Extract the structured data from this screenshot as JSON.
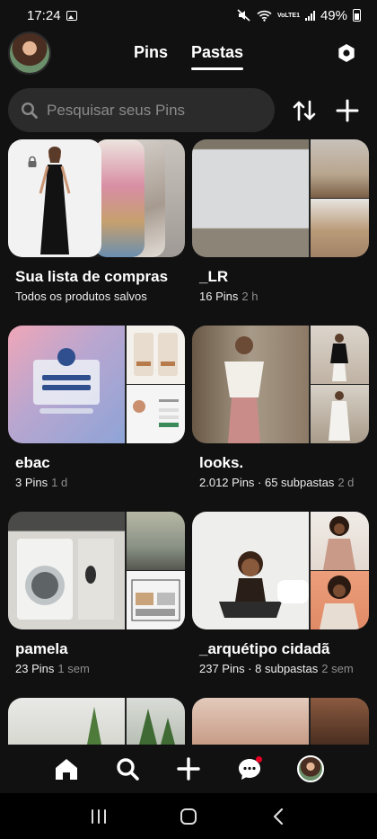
{
  "status_bar": {
    "time": "17:24",
    "volte": "VoLTE1",
    "battery": "49%"
  },
  "header": {
    "tabs": [
      {
        "label": "Pins",
        "active": false
      },
      {
        "label": "Pastas",
        "active": true
      }
    ]
  },
  "search": {
    "placeholder": "Pesquisar seus Pins"
  },
  "boards": [
    {
      "title": "Sua lista de compras",
      "meta": "Todos os produtos salvos",
      "age": ""
    },
    {
      "title": "_LR",
      "meta": "16 Pins",
      "age": "2 h"
    },
    {
      "title": "ebac",
      "meta": "3 Pins",
      "age": "1 d"
    },
    {
      "title": "looks.",
      "meta": "2.012 Pins · 65 subpastas",
      "age": "2 d"
    },
    {
      "title": "pamela",
      "meta": "23 Pins",
      "age": "1 sem"
    },
    {
      "title": "_arquétipo cidadã",
      "meta": "237 Pins · 8 subpastas",
      "age": "2 sem"
    }
  ],
  "icons": {
    "settings": "gear-icon",
    "sort": "sort-icon",
    "add": "plus-icon",
    "home": "home-icon",
    "search": "search-icon",
    "create": "plus-icon",
    "messages": "chat-icon",
    "profile": "avatar"
  },
  "colors": {
    "background": "#111111",
    "search_bg": "#2b2b2b",
    "notification": "#e60023"
  }
}
